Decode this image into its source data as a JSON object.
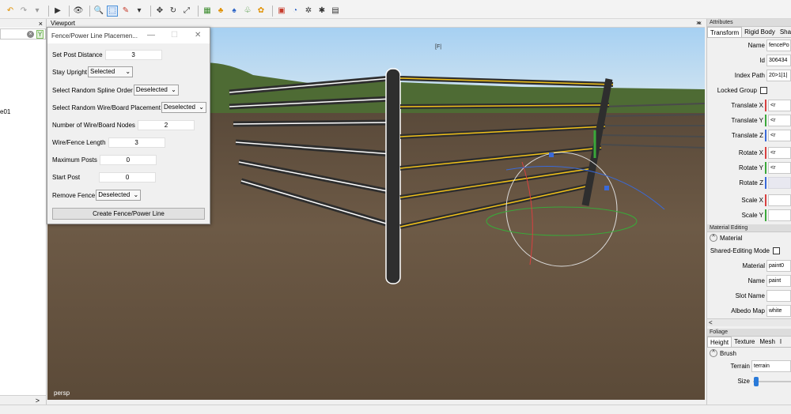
{
  "window": {
    "title": "Fence/Power Line Placemen..."
  },
  "toolbar": {
    "icons": [
      "undo-icon",
      "redo-icon",
      "play-icon",
      "eye-icon",
      "zoom-icon",
      "select-icon",
      "paint-icon",
      "move-icon",
      "rotate-icon",
      "scale-icon",
      "vegetation-icon",
      "fence-icon",
      "lights-icon",
      "camera-icon",
      "stats-icon",
      "settings-icon",
      "render-icon"
    ]
  },
  "left_panel": {
    "close": "×",
    "item": "e01",
    "scroll_arrow": ">"
  },
  "viewport": {
    "title": "Viewport",
    "close": "×",
    "camera": "persp",
    "background_text": "[F|"
  },
  "dialog": {
    "title": "Fence/Power Line Placemen...",
    "min": "—",
    "max": "☐",
    "close": "✕",
    "fields": {
      "post_distance": {
        "label": "Set Post Distance",
        "value": "3"
      },
      "stay_upright": {
        "label": "Stay Upright",
        "value": "Selected"
      },
      "random_spline": {
        "label": "Select Random Spline Order",
        "value": "Deselected"
      },
      "random_wire": {
        "label": "Select Random Wire/Board Placement",
        "value": "Deselected"
      },
      "wire_nodes": {
        "label": "Number of Wire/Board Nodes",
        "value": "2"
      },
      "fence_length": {
        "label": "Wire/Fence Length",
        "value": "3"
      },
      "max_posts": {
        "label": "Maximum Posts",
        "value": "0"
      },
      "start_post": {
        "label": "Start Post",
        "value": "0"
      },
      "remove_fence": {
        "label": "Remove Fence",
        "value": "Deselected"
      }
    },
    "create_button": "Create Fence/Power Line"
  },
  "attributes": {
    "title": "Attributes",
    "close": "×",
    "tabs": [
      "Transform",
      "Rigid Body",
      "Sha"
    ],
    "name_label": "Name",
    "name_value": "fencePo",
    "id_label": "Id",
    "id_value": "306434",
    "index_label": "Index Path",
    "index_value": "20>1|1|",
    "locked_label": "Locked Group",
    "translate": [
      {
        "label": "Translate X",
        "value": "<r"
      },
      {
        "label": "Translate Y",
        "value": "<r"
      },
      {
        "label": "Translate Z",
        "value": "<r"
      }
    ],
    "rotate": [
      {
        "label": "Rotate X",
        "value": "<r"
      },
      {
        "label": "Rotate Y",
        "value": "<r"
      },
      {
        "label": "Rotate Z",
        "value": ""
      }
    ],
    "scale": [
      {
        "label": "Scale X",
        "value": ""
      },
      {
        "label": "Scale Y",
        "value": ""
      }
    ],
    "axis_colors": {
      "x": "#d94040",
      "y": "#3aa83a",
      "z": "#3a6ad9"
    }
  },
  "material_editing": {
    "title": "Material Editing",
    "section": "Material",
    "shared_label": "Shared-Editing Mode",
    "material_label": "Material",
    "material_value": "paint0",
    "name_label": "Name",
    "name_value": "paint",
    "slot_label": "Slot Name",
    "slot_value": "",
    "albedo_label": "Albedo Map",
    "albedo_value": "white",
    "scroll_left": "<"
  },
  "foliage": {
    "title": "Foliage",
    "tabs": [
      "Height",
      "Texture",
      "Mesh",
      "I"
    ],
    "section": "Brush",
    "terrain_label": "Terrain",
    "terrain_value": "terrain",
    "size_label": "Size",
    "size_level": 0.05
  }
}
